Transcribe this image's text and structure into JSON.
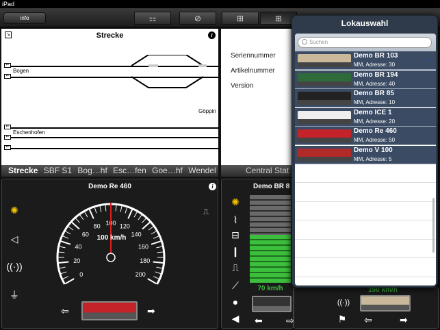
{
  "statusbar": {
    "device": "iPad"
  },
  "toolbar": {
    "info_label": "info",
    "segments": [
      {
        "icon": "track-layout-icon",
        "glyph": "⚏"
      },
      {
        "icon": "gauge-icon",
        "glyph": "⊘"
      },
      {
        "icon": "keyboard-panel-icon",
        "glyph": "⊞"
      },
      {
        "icon": "grid-panel-icon",
        "glyph": "⊞"
      }
    ]
  },
  "strecke": {
    "title": "Strecke",
    "labels": {
      "bogen": "Bogen",
      "eschenhofen": "Eschenhofen",
      "goeppin": "Göppin"
    },
    "tabs": [
      "Strecke",
      "SBF S1",
      "Bog…hf",
      "Esc…fen",
      "Goe…hf",
      "Wendel"
    ]
  },
  "central_station": {
    "fields": [
      "Seriennummer",
      "Artikelnummer",
      "Version"
    ],
    "tab_label": "Central Stat"
  },
  "cab1": {
    "title": "Demo Re 460",
    "speed_readout": "100 km/h",
    "speed_value": 100,
    "speed_max": 200,
    "ticks": [
      "0",
      "20",
      "40",
      "60",
      "80",
      "100",
      "120",
      "140",
      "160",
      "180",
      "200"
    ]
  },
  "cab2": {
    "title": "Demo BR 8",
    "speed_readout": "70 km/h",
    "speed_fraction": 0.55
  },
  "cab3": {
    "speed_readout": "150 km/h"
  },
  "lokauswahl": {
    "title": "Lokauswahl",
    "search_placeholder": "Suchen",
    "items": [
      {
        "name": "Demo BR 103",
        "addr": "MM, Adresse: 30",
        "selected": true,
        "color": "#c9b89a"
      },
      {
        "name": "Demo BR 194",
        "addr": "MM, Adresse: 40",
        "selected": false,
        "color": "#2f6b3a"
      },
      {
        "name": "Demo BR 85",
        "addr": "MM, Adresse: 10",
        "selected": false,
        "color": "#222222"
      },
      {
        "name": "Demo ICE 1",
        "addr": "MM, Adresse: 20",
        "selected": false,
        "color": "#eeeeee"
      },
      {
        "name": "Demo Re 460",
        "addr": "MM, Adresse: 50",
        "selected": false,
        "color": "#c4232a"
      },
      {
        "name": "Demo V 100",
        "addr": "MM, Adresse: 5",
        "selected": false,
        "color": "#b02a2a"
      }
    ]
  }
}
